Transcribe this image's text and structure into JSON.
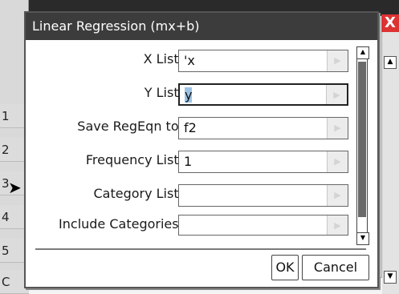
{
  "background": {
    "row_numbers": [
      "1",
      "2",
      "3",
      "4",
      "5",
      "C"
    ],
    "close_symbol": "X"
  },
  "dialog": {
    "title": "Linear Regression (mx+b)",
    "fields": [
      {
        "label": "X List:",
        "value": "'x",
        "selected": false,
        "active": false
      },
      {
        "label": "Y List:",
        "value": "y",
        "selected": true,
        "active": true
      },
      {
        "label": "Save RegEqn to:",
        "value": "f2",
        "selected": false,
        "active": false
      },
      {
        "label": "Frequency List:",
        "value": "1",
        "selected": false,
        "active": false
      },
      {
        "label": "Category List:",
        "value": "",
        "selected": false,
        "active": false
      },
      {
        "label": "Include Categories:",
        "value": "",
        "selected": false,
        "active": false
      }
    ],
    "ok_label": "OK",
    "cancel_label": "Cancel"
  },
  "colors": {
    "titlebar": "#3c3c3c",
    "selection": "#9cc3e6",
    "close": "#dd3333"
  }
}
